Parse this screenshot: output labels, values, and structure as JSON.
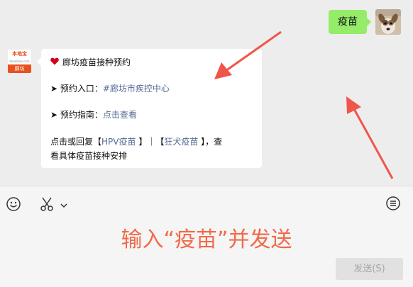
{
  "outgoing_message": {
    "text": "疫苗"
  },
  "sender_avatar": {
    "top_text": "本地宝",
    "mid_text": "bendibao.com",
    "bottom_text": "廊坊"
  },
  "incoming_message": {
    "title": "廊坊疫苗接种预约",
    "booking_label": "➤ 预约入口：",
    "booking_link": "#廊坊市疾控中心",
    "guide_label": "➤ 预约指南：",
    "guide_link": "点击查看",
    "reply_prefix": "点击或回复【",
    "hpv_link": "HPV疫苗",
    "reply_separator": " 】｜【",
    "rabies_link": "狂犬疫苗",
    "reply_suffix": " 】，查",
    "reply_line2": "看具体疫苗接种安排"
  },
  "instruction": "输入“疫苗”并发送",
  "send_button": "发送(S)",
  "icons": {
    "emoji": "emoji-icon",
    "scissors": "scissors-icon",
    "chevron": "chevron-down-icon",
    "history": "chat-history-icon",
    "heart": "heart-icon"
  },
  "colors": {
    "bubble_me": "#95ec69",
    "link": "#576b95",
    "arrow": "#f0554a",
    "instruction": "#f06a4a"
  }
}
